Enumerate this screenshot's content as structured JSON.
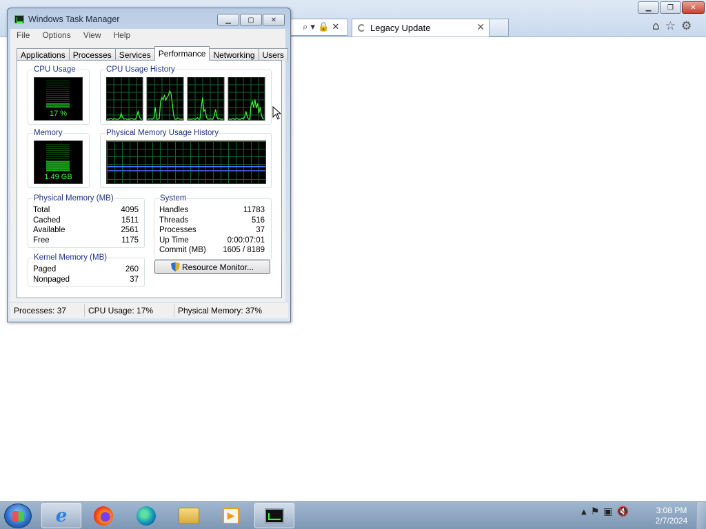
{
  "browser": {
    "tab_title": "Legacy Update",
    "tab_close": "✕",
    "address_icons": "⌕ ▾ 🔒 ✕",
    "toolbar_icons": [
      "home-icon",
      "star-icon",
      "gear-icon"
    ],
    "caption": {
      "min": "▁",
      "max": "❐",
      "close": "✕"
    }
  },
  "task_manager": {
    "title": "Windows Task Manager",
    "menu": [
      "File",
      "Options",
      "View",
      "Help"
    ],
    "tabs": [
      "Applications",
      "Processes",
      "Services",
      "Performance",
      "Networking",
      "Users"
    ],
    "active_tab": "Performance",
    "cpu_usage_label": "CPU Usage",
    "cpu_usage_value": "17 %",
    "cpu_usage_fraction": 0.17,
    "cpu_history_label": "CPU Usage History",
    "memory_label": "Memory",
    "memory_value": "1.49 GB",
    "memory_fraction": 0.37,
    "mem_history_label": "Physical Memory Usage History",
    "physical_memory": {
      "label": "Physical Memory (MB)",
      "rows": [
        {
          "k": "Total",
          "v": "4095"
        },
        {
          "k": "Cached",
          "v": "1511"
        },
        {
          "k": "Available",
          "v": "2561"
        },
        {
          "k": "Free",
          "v": "1175"
        }
      ]
    },
    "kernel_memory": {
      "label": "Kernel Memory (MB)",
      "rows": [
        {
          "k": "Paged",
          "v": "260"
        },
        {
          "k": "Nonpaged",
          "v": "37"
        }
      ]
    },
    "system": {
      "label": "System",
      "rows": [
        {
          "k": "Handles",
          "v": "11783"
        },
        {
          "k": "Threads",
          "v": "516"
        },
        {
          "k": "Processes",
          "v": "37"
        },
        {
          "k": "Up Time",
          "v": "0:00:07:01"
        },
        {
          "k": "Commit (MB)",
          "v": "1605 / 8189"
        }
      ]
    },
    "resource_monitor_button": "Resource Monitor...",
    "status": {
      "processes": "Processes: 37",
      "cpu": "CPU Usage: 17%",
      "memory": "Physical Memory: 37%"
    }
  },
  "taskbar": {
    "apps": [
      "internet-explorer",
      "firefox",
      "edge",
      "file-explorer",
      "media-player",
      "task-manager"
    ],
    "time": "3:08 PM",
    "date": "2/7/2024"
  }
}
